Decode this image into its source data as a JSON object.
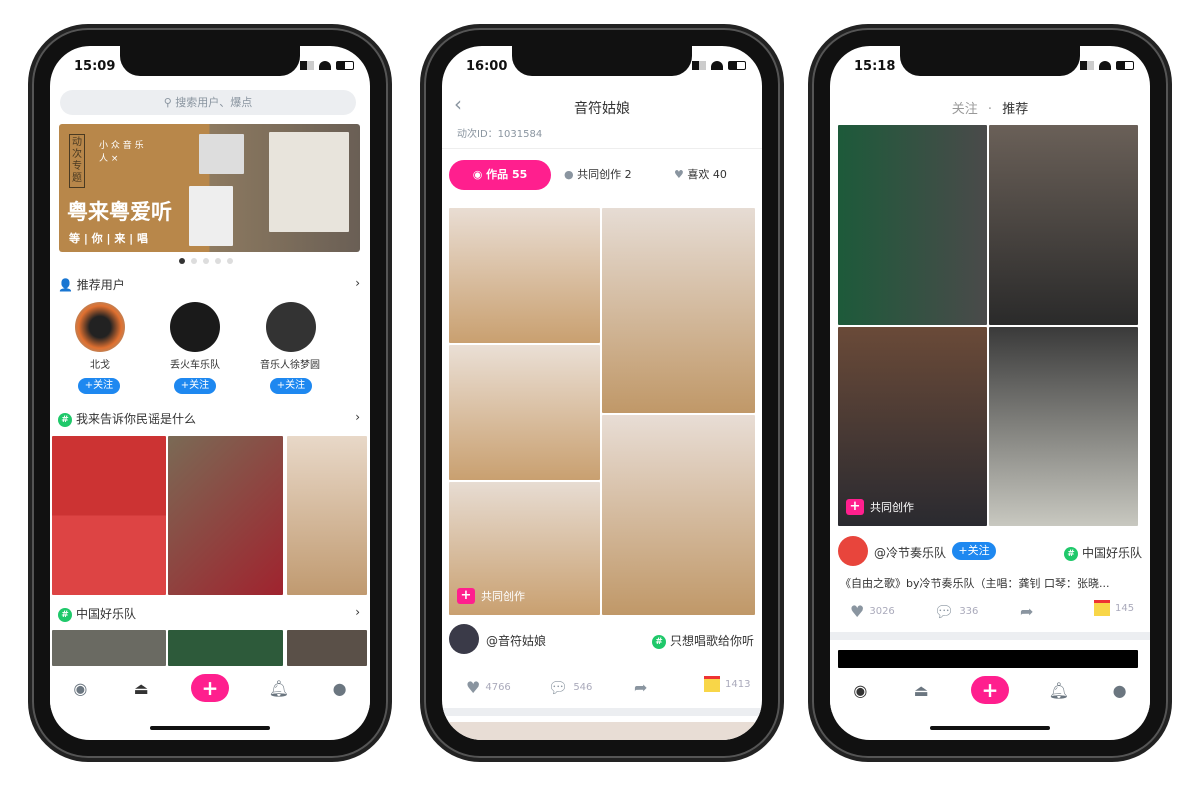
{
  "accent": "#ff1f8e",
  "follow_color": "#1e88f0",
  "topic_color": "#1fc86a",
  "phone1": {
    "time": "15:09",
    "search_placeholder": "搜索用户、爆点",
    "banner": {
      "tag": "动次专题",
      "side": "小 众 音 乐 人 ×",
      "title": "粤来粤爱听",
      "subtitle": "等 | 你 | 来 | 唱"
    },
    "recommended_title": "推荐用户",
    "users": [
      {
        "name": "北戈",
        "follow": "+关注"
      },
      {
        "name": "丢火车乐队",
        "follow": "+关注"
      },
      {
        "name": "音乐人徐梦圆",
        "follow": "+关注"
      }
    ],
    "topics": [
      {
        "title": "我来告诉你民谣是什么"
      },
      {
        "title": "中国好乐队"
      }
    ]
  },
  "phone2": {
    "time": "16:00",
    "title": "音符姑娘",
    "id_label": "动次ID：1031584",
    "tabs": [
      {
        "label": "作品 55",
        "icon": "eye-icon"
      },
      {
        "label": "共同创作 2",
        "icon": "lightbulb-icon"
      },
      {
        "label": "喜欢 40",
        "icon": "heart-icon"
      }
    ],
    "co_create": "共同创作",
    "author": "@音符姑娘",
    "topic": "只想唱歌给你听",
    "likes": "4766",
    "comments": "546",
    "gifts": "1413"
  },
  "phone3": {
    "time": "15:18",
    "tab_follow": "关注",
    "tab_sep": "·",
    "tab_recommend": "推荐",
    "co_create": "共同创作",
    "author": "@冷节奏乐队",
    "follow": "+关注",
    "topic": "中国好乐队",
    "description": "《自由之歌》by冷节奏乐队（主唱：龚钊 口琴：张晓...",
    "likes": "3026",
    "comments": "336",
    "gifts": "145"
  },
  "tabbar": [
    "eye-icon",
    "cloche-icon",
    "plus-icon",
    "bell-icon",
    "user-icon"
  ]
}
